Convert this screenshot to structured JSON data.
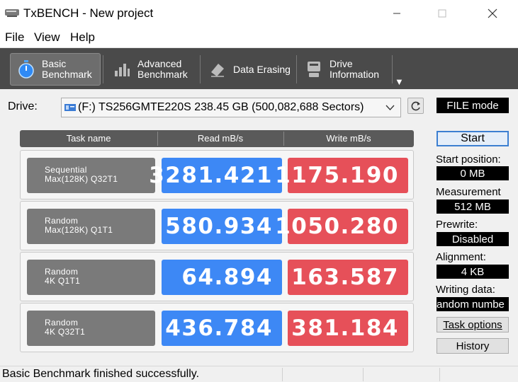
{
  "window": {
    "title": "TxBENCH - New project"
  },
  "menu": [
    "File",
    "View",
    "Help"
  ],
  "toolbar": {
    "buttons": [
      {
        "line1": "Basic",
        "line2": "Benchmark",
        "icon": "stopwatch-icon"
      },
      {
        "line1": "Advanced",
        "line2": "Benchmark",
        "icon": "bar-chart-icon"
      },
      {
        "line1": "Data Erasing",
        "line2": "",
        "icon": "eraser-icon"
      },
      {
        "line1": "Drive",
        "line2": "Information",
        "icon": "drive-info-icon"
      }
    ]
  },
  "drive": {
    "label": "Drive:",
    "selected": "(F:) TS256GMTE220S  238.45 GB (500,082,688 Sectors)",
    "mode": "FILE mode"
  },
  "table": {
    "headers": [
      "Task name",
      "Read mB/s",
      "Write mB/s"
    ],
    "rows": [
      {
        "task_line1": "Sequential",
        "task_line2": "Max(128K) Q32T1",
        "read": "3281.421",
        "write": "1175.190"
      },
      {
        "task_line1": "Random",
        "task_line2": "Max(128K) Q1T1",
        "read": "580.934",
        "write": "1050.280"
      },
      {
        "task_line1": "Random",
        "task_line2": "4K Q1T1",
        "read": "64.894",
        "write": "163.587"
      },
      {
        "task_line1": "Random",
        "task_line2": "4K Q32T1",
        "read": "436.784",
        "write": "381.184"
      }
    ]
  },
  "side": {
    "start_label": "Start",
    "start_position_label": "Start position:",
    "start_position_value": "0 MB",
    "measurement_label": "Measurement",
    "measurement_value": "512 MB",
    "prewrite_label": "Prewrite:",
    "prewrite_value": "Disabled",
    "alignment_label": "Alignment:",
    "alignment_value": "4 KB",
    "writing_data_label": "Writing data:",
    "writing_data_value": "andom numbe",
    "task_options_label": "Task options",
    "history_label": "History"
  },
  "status": {
    "text": "Basic Benchmark finished successfully."
  },
  "colors": {
    "read": "#3d88f5",
    "write": "#e65059",
    "toolbar": "#4a4a4a"
  }
}
